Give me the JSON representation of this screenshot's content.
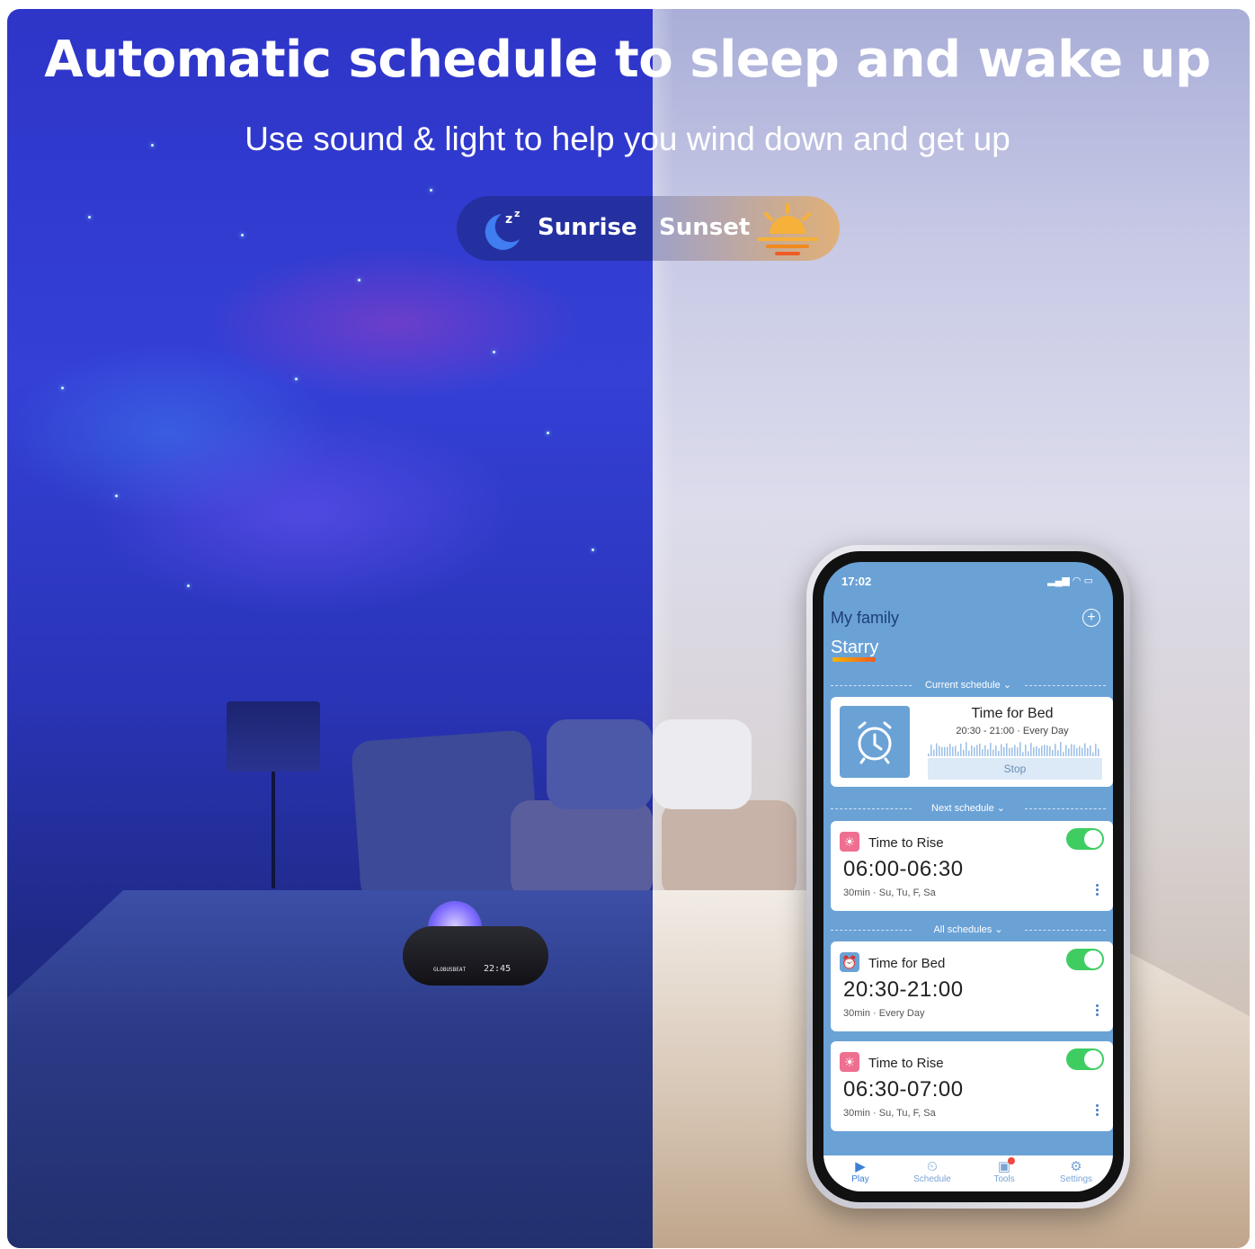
{
  "headline": {
    "title": "Automatic schedule to sleep and wake up",
    "subtitle": "Use sound & light to help you wind down and get up"
  },
  "mode_pill": {
    "left_label": "Sunrise",
    "right_label": "Sunset",
    "left_icon": "moon-sleep-icon",
    "right_icon": "sunset-icon",
    "left_color": "#2430a0",
    "right_color": "#e0b078"
  },
  "device": {
    "brand": "GLOBUSBEAT",
    "display_time": "22:45"
  },
  "phone": {
    "status_time": "17:02",
    "family_label": "My family",
    "device_name": "Starry",
    "current_section": "Current schedule",
    "current": {
      "title": "Time for Bed",
      "meta": "20:30 - 21:00 · Every Day",
      "stop_label": "Stop"
    },
    "next_section": "Next schedule",
    "next": {
      "title": "Time to Rise",
      "time": "06:00-06:30",
      "meta": "30min · Su, Tu, F, Sa",
      "enabled": true
    },
    "all_section": "All schedules",
    "all": [
      {
        "title": "Time for Bed",
        "time": "20:30-21:00",
        "meta": "30min · Every Day",
        "enabled": true,
        "icon": "alarm-clock-icon",
        "icon_color": "#6aa2d6"
      },
      {
        "title": "Time to Rise",
        "time": "06:30-07:00",
        "meta": "30min · Su, Tu, F, Sa",
        "enabled": true,
        "icon": "sunrise-icon",
        "icon_color": "#ee6f8f"
      }
    ],
    "tabs": [
      {
        "label": "Play",
        "icon": "play-icon",
        "active": true
      },
      {
        "label": "Schedule",
        "icon": "clock-icon",
        "active": false
      },
      {
        "label": "Tools",
        "icon": "toolbox-icon",
        "active": false,
        "badge": true
      },
      {
        "label": "Settings",
        "icon": "settings-icon",
        "active": false
      }
    ],
    "accent_color": "#6aa2d6",
    "toggle_color": "#3fcd62"
  }
}
